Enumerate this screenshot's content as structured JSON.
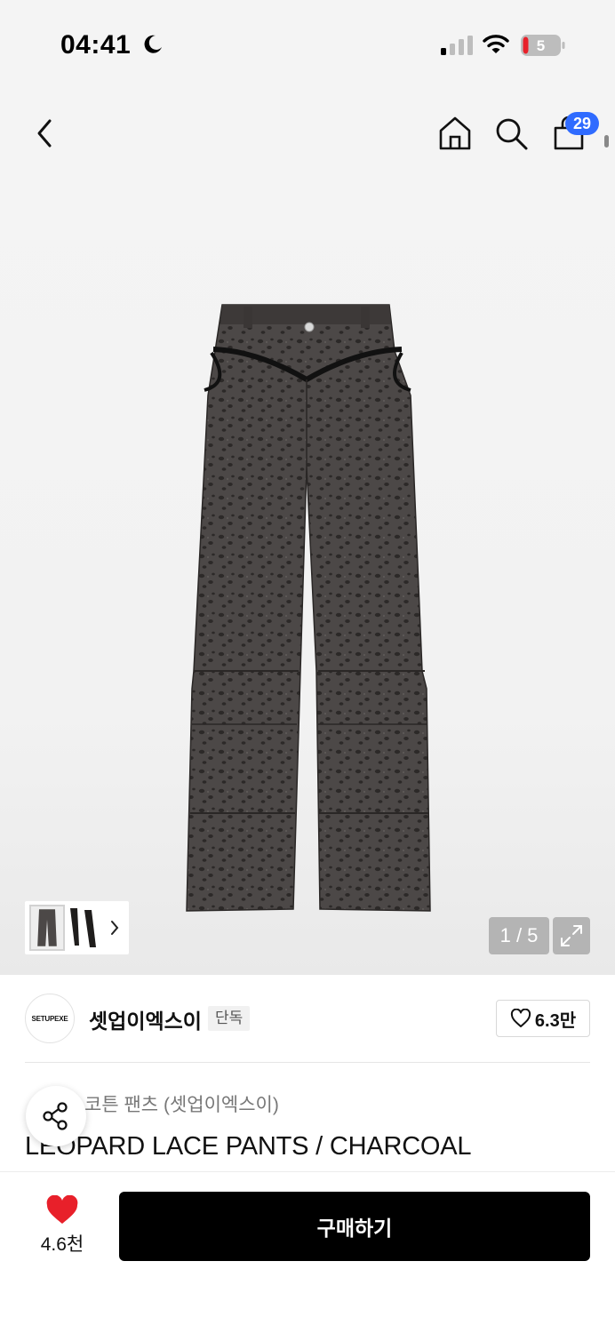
{
  "status_bar": {
    "time": "04:41",
    "battery_level": "5",
    "icons": [
      "moon-icon",
      "signal-icon",
      "wifi-icon",
      "battery-icon"
    ]
  },
  "nav": {
    "icons": [
      "back-icon",
      "home-icon",
      "search-icon",
      "cart-icon"
    ],
    "cart_count": "29"
  },
  "gallery": {
    "counter": "1 / 5",
    "icons": [
      "expand-icon",
      "chevron-right-icon"
    ]
  },
  "brand": {
    "logo_text": "SETUPEXE",
    "name": "셋업이엑스이",
    "tag": "단독",
    "like_count": "6.3만"
  },
  "product": {
    "category": "코튼 팬츠 (셋업이엑스이)",
    "title": "LEOPARD LACE PANTS / CHARCOAL"
  },
  "bottom_bar": {
    "wish_count": "4.6천",
    "buy_label": "구매하기"
  },
  "colors": {
    "accent_badge": "#2f6bff",
    "heart": "#e8202a",
    "buy_button": "#000000",
    "pants": "#4a4645"
  }
}
